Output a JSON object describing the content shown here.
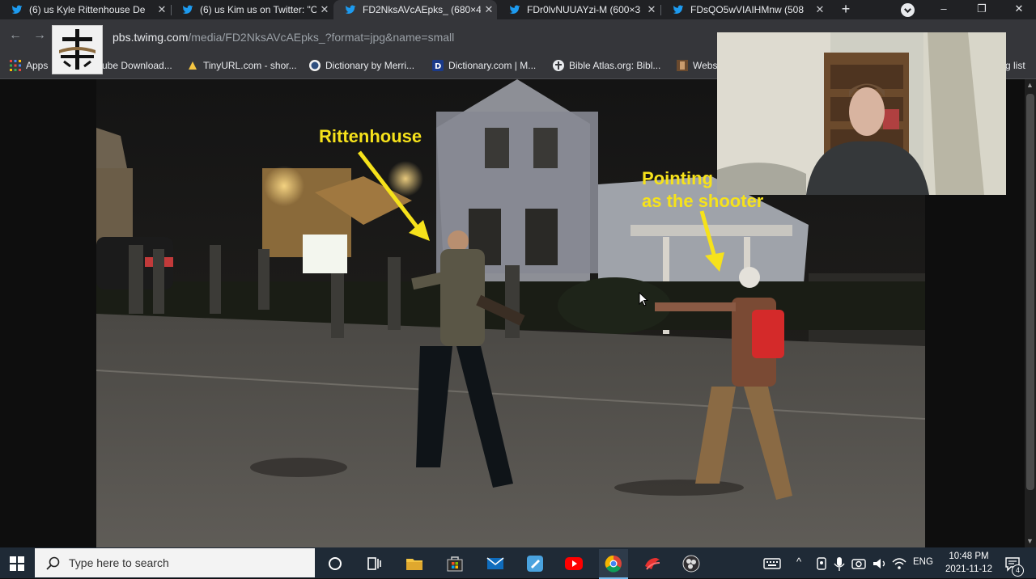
{
  "browser": {
    "tabs": [
      {
        "title": "(6) us Kyle Rittenhouse De",
        "active": false
      },
      {
        "title": "(6) us Kim us on Twitter: \"C",
        "active": false
      },
      {
        "title": "FD2NksAVcAEpks_ (680×4",
        "active": true
      },
      {
        "title": "FDr0lvNUUAYzi-M (600×3",
        "active": false
      },
      {
        "title": "FDsQO5wVIAIHMnw (508",
        "active": false
      }
    ],
    "url_host": "pbs.twimg.com",
    "url_path": "/media/FD2NksAVcAEpks_?format=jpg&name=small",
    "bookmarks": [
      {
        "label": "Apps",
        "icon": "apps-grid-icon"
      },
      {
        "label": "ube Download...",
        "icon": "youtube-download-icon"
      },
      {
        "label": "TinyURL.com - shor...",
        "icon": "tinyurl-icon"
      },
      {
        "label": "Dictionary by Merri...",
        "icon": "merriam-webster-icon"
      },
      {
        "label": "Dictionary.com | M...",
        "icon": "dictionary-com-icon"
      },
      {
        "label": "Bible Atlas.org: Bibl...",
        "icon": "bible-atlas-icon"
      },
      {
        "label": "Webs",
        "icon": "website-icon"
      },
      {
        "label": "g list",
        "icon": "reading-list-icon"
      }
    ],
    "window_controls": [
      "–",
      "❐",
      "✕"
    ]
  },
  "image_annotations": {
    "label_left": "Rittenhouse",
    "label_right_line1": "Pointing",
    "label_right_line2": "as the shooter"
  },
  "taskbar": {
    "search_placeholder": "Type here to search",
    "language": "ENG",
    "time": "10:48 PM",
    "date": "2021-11-12",
    "notification_count": "4"
  },
  "colors": {
    "tab_bar": "#202124",
    "toolbar": "#35363a",
    "taskbar": "#1f2a36",
    "annotation_yellow": "#f6e21b",
    "twitter_blue": "#1d9bf0"
  }
}
